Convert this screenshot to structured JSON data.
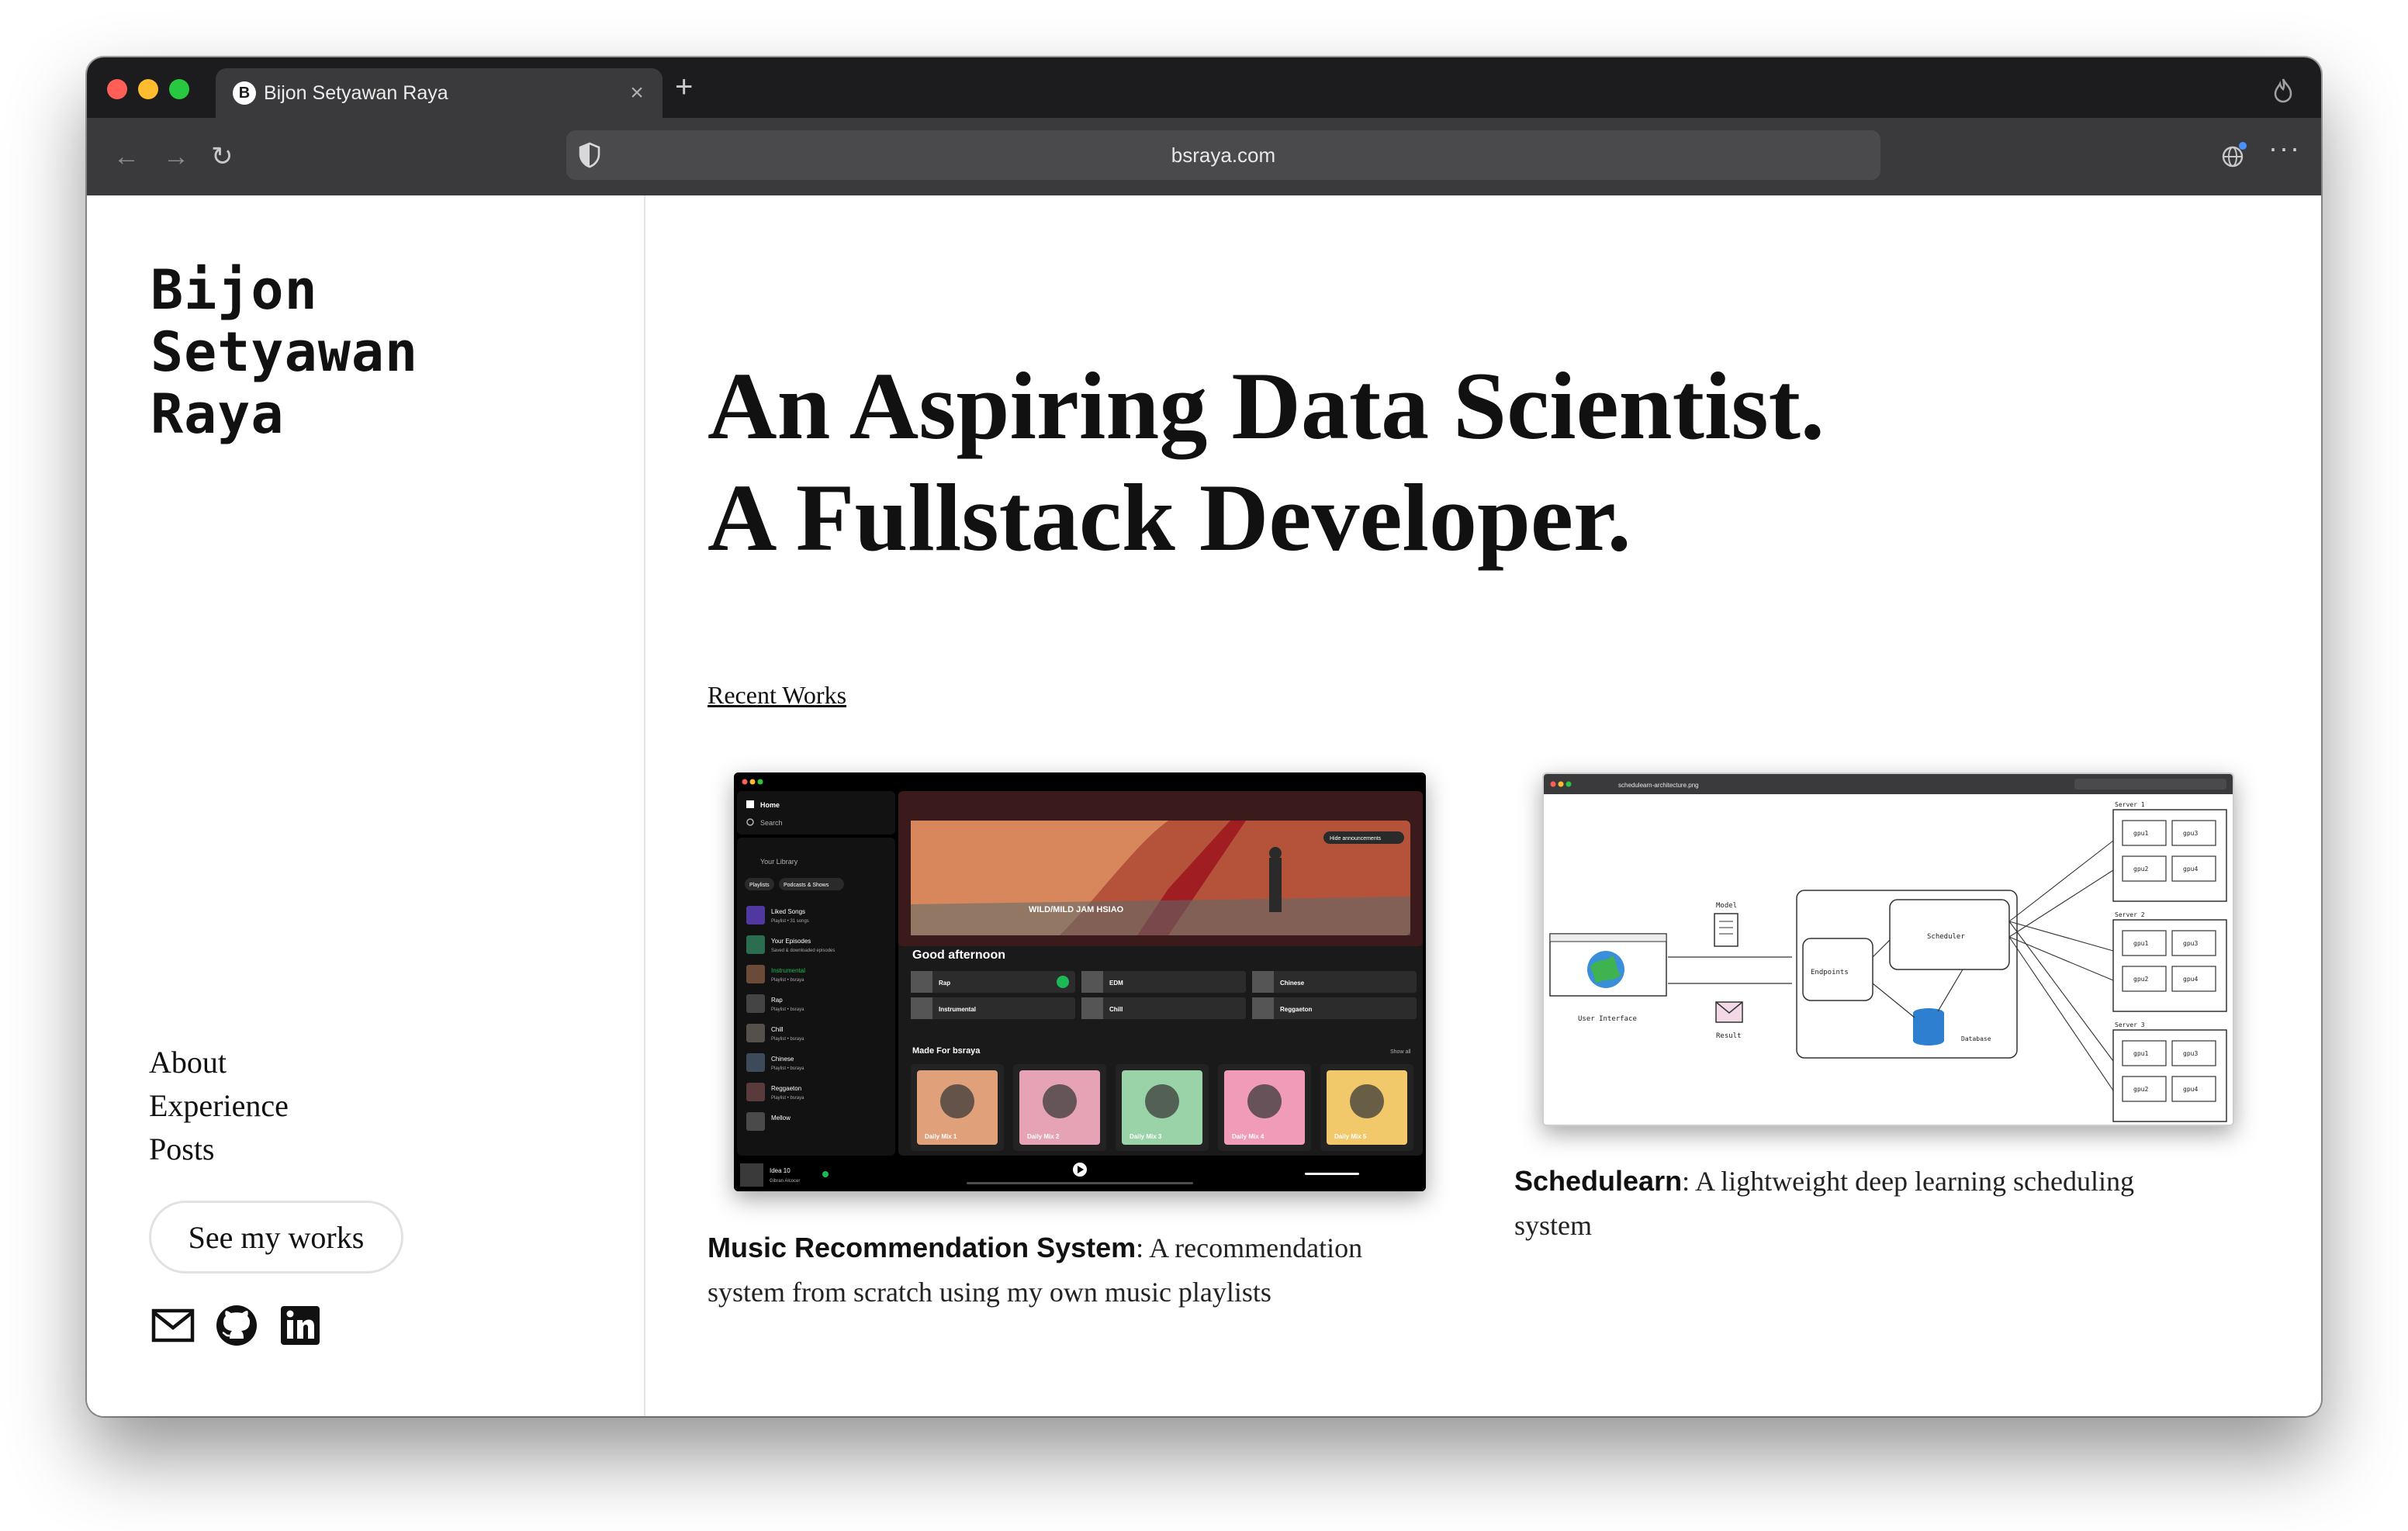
{
  "browser": {
    "tab_title": "Bijon Setyawan Raya",
    "favicon_letter": "B",
    "close_glyph": "×",
    "new_tab_glyph": "+",
    "back_glyph": "←",
    "forward_glyph": "→",
    "reload_glyph": "↻",
    "more_glyph": "···",
    "url": "bsraya.com"
  },
  "sidebar": {
    "name_lines": [
      "Bijon",
      "Setyawan",
      "Raya"
    ],
    "nav": [
      {
        "label": "About"
      },
      {
        "label": "Experience"
      },
      {
        "label": "Posts"
      }
    ],
    "cta_label": "See my works",
    "socials": [
      "mail-icon",
      "github-icon",
      "linkedin-icon"
    ]
  },
  "main": {
    "hero_lines": [
      "An Aspiring Data Scientist.",
      "A Fullstack Developer."
    ],
    "section_label": "Recent Works",
    "works": [
      {
        "title": "Music Recommendation System",
        "description": ": A recommendation system from scratch using my own music playlists"
      },
      {
        "title": "Schedulearn",
        "description": ": A lightweight deep learning scheduling system"
      }
    ]
  },
  "spotify_shot": {
    "nav": [
      "Home",
      "Search"
    ],
    "library_label": "Your Library",
    "filters": [
      "Playlists",
      "Podcasts & Shows"
    ],
    "library_items": [
      {
        "name": "Liked Songs",
        "sub": "Playlist • 31 songs"
      },
      {
        "name": "Your Episodes",
        "sub": "Saved & downloaded episodes"
      },
      {
        "name": "Instrumental",
        "sub": "Playlist • bsraya"
      },
      {
        "name": "Rap",
        "sub": "Playlist • bsraya"
      },
      {
        "name": "Chill",
        "sub": "Playlist • bsraya"
      },
      {
        "name": "Chinese",
        "sub": "Playlist • bsraya"
      },
      {
        "name": "Reggaeton",
        "sub": "Playlist • bsraya"
      },
      {
        "name": "Mellow",
        "sub": ""
      }
    ],
    "banner_text": "WILD/MILD JAM HSIAO",
    "hide_label": "Hide announcements",
    "greeting": "Good afternoon",
    "quick": [
      "Rap",
      "EDM",
      "Chinese",
      "Instrumental",
      "Chill",
      "Reggaeton"
    ],
    "made_for": "Made For bsraya",
    "show_all": "Show all",
    "mixes": [
      "Daily Mix 1",
      "Daily Mix 2",
      "Daily Mix 3",
      "Daily Mix 4",
      "Daily Mix 5"
    ],
    "now_playing": "Idea 10",
    "now_artist": "Gibran Alcocer",
    "colors": {
      "bg": "#121212",
      "panel": "#181818",
      "accent": "#1db954",
      "banner": "#b5533a"
    }
  },
  "arch_shot": {
    "file_name": "schedulearn-architecture.png",
    "labels": {
      "user_interface": "User Interface",
      "model": "Model",
      "result": "Result",
      "endpoints": "Endpoints",
      "scheduler": "Scheduler",
      "database": "Database"
    },
    "servers": [
      {
        "name": "Server 1",
        "gpus": [
          "gpu1",
          "gpu3",
          "gpu2",
          "gpu4"
        ]
      },
      {
        "name": "Server 2",
        "gpus": [
          "gpu1",
          "gpu3",
          "gpu2",
          "gpu4"
        ]
      },
      {
        "name": "Server 3",
        "gpus": [
          "gpu1",
          "gpu3",
          "gpu2",
          "gpu4"
        ]
      }
    ]
  }
}
